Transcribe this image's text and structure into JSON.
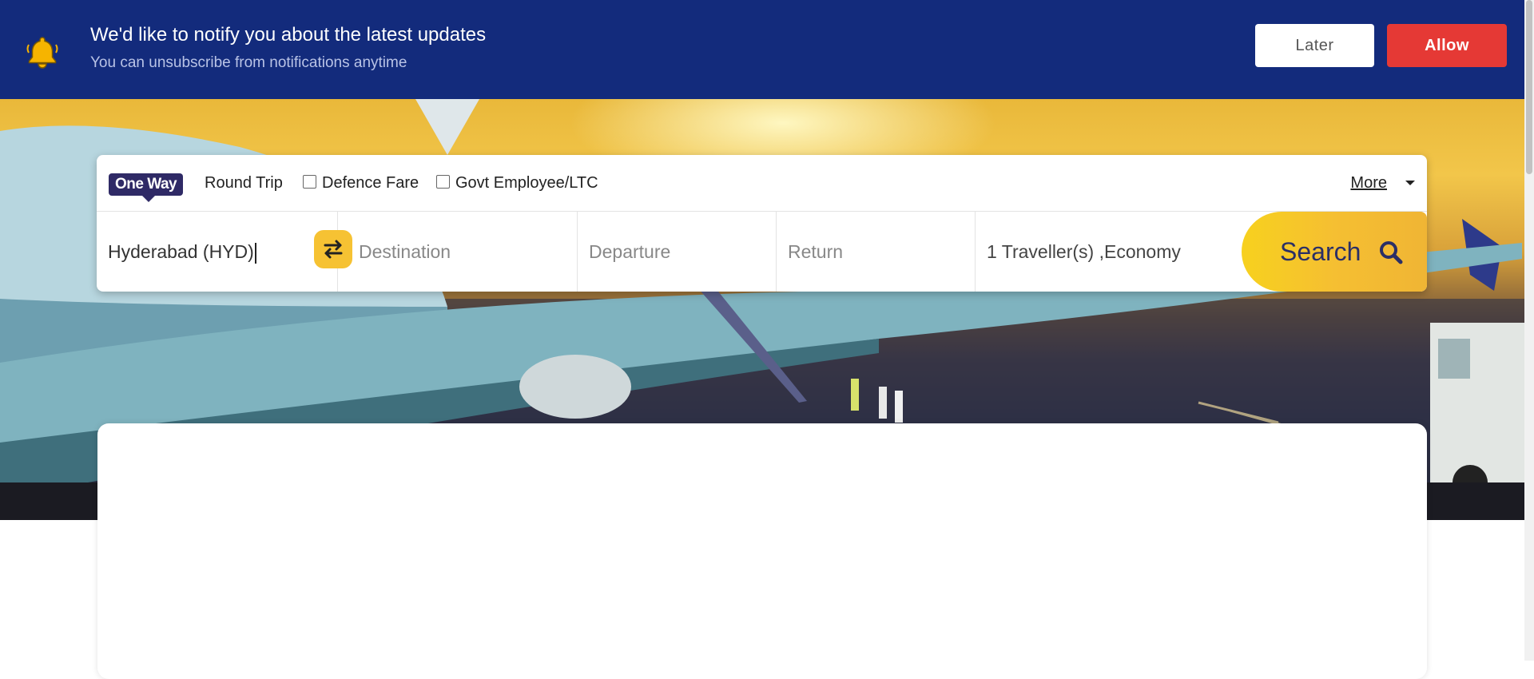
{
  "notification": {
    "title": "We'd like to notify you about the latest updates",
    "subtitle": "You can unsubscribe from notifications anytime",
    "later_label": "Later",
    "allow_label": "Allow",
    "icon": "bell-icon",
    "bg_color": "#132b7c",
    "allow_color": "#e53935"
  },
  "trip_types": {
    "one_way": "One Way",
    "round_trip": "Round Trip",
    "defence_fare": "Defence Fare",
    "govt_employee": "Govt Employee/LTC",
    "more": "More",
    "selected": "One Way"
  },
  "search_form": {
    "origin_value": "Hyderabad (HYD)",
    "destination_placeholder": "Destination",
    "departure_placeholder": "Departure",
    "return_placeholder": "Return",
    "travellers_value": "1 Traveller(s) ,Economy",
    "search_label": "Search",
    "accent_color": "#f6c233",
    "brand_color": "#2f2a66"
  },
  "icons": {
    "swap": "swap-arrows-icon",
    "search": "magnifier-icon",
    "more": "caret-down-icon"
  }
}
